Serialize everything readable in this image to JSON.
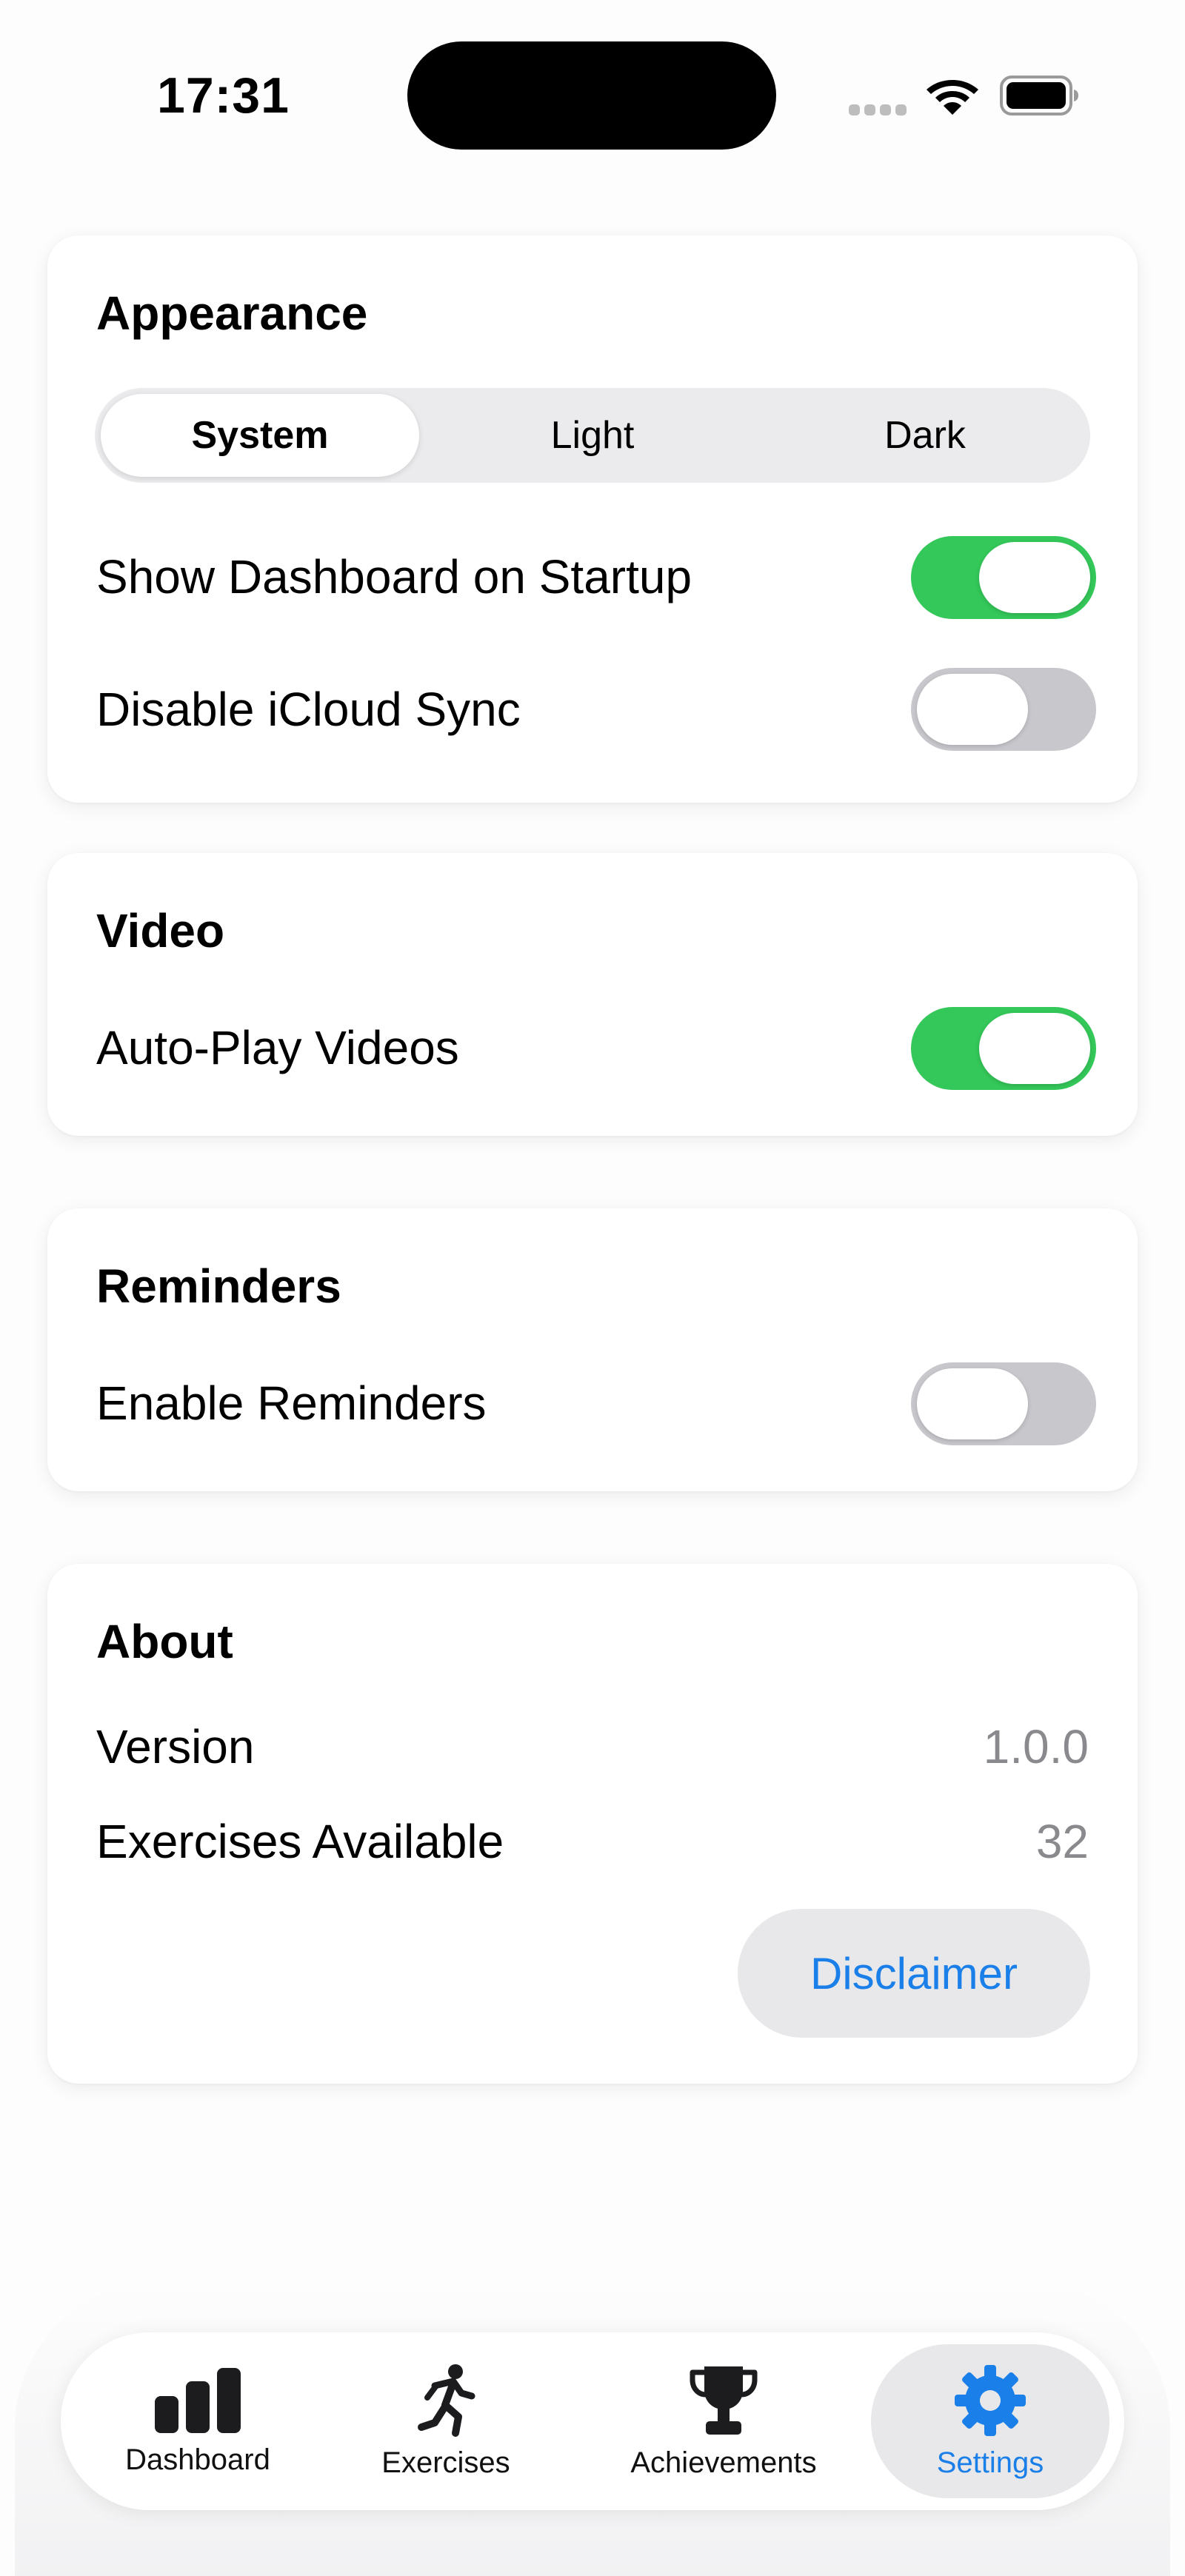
{
  "status_bar": {
    "time": "17:31"
  },
  "appearance": {
    "title": "Appearance",
    "segments": [
      "System",
      "Light",
      "Dark"
    ],
    "selected_segment": "System",
    "show_dashboard_label": "Show Dashboard on Startup",
    "show_dashboard_on": true,
    "disable_icloud_label": "Disable iCloud Sync",
    "disable_icloud_on": false
  },
  "video": {
    "title": "Video",
    "autoplay_label": "Auto-Play Videos",
    "autoplay_on": true
  },
  "reminders": {
    "title": "Reminders",
    "enable_label": "Enable Reminders",
    "enable_on": false
  },
  "about": {
    "title": "About",
    "version_label": "Version",
    "version_value": "1.0.0",
    "exercises_label": "Exercises Available",
    "exercises_value": "32",
    "disclaimer_label": "Disclaimer"
  },
  "tab_bar": {
    "tabs": [
      {
        "label": "Dashboard",
        "icon": "bar-chart-icon"
      },
      {
        "label": "Exercises",
        "icon": "running-figure-icon"
      },
      {
        "label": "Achievements",
        "icon": "trophy-icon"
      },
      {
        "label": "Settings",
        "icon": "gear-icon"
      }
    ],
    "active": "Settings"
  },
  "colors": {
    "accent": "#1a7fe8",
    "toggle_on": "#34c759",
    "toggle_off": "#c7c7cc"
  }
}
